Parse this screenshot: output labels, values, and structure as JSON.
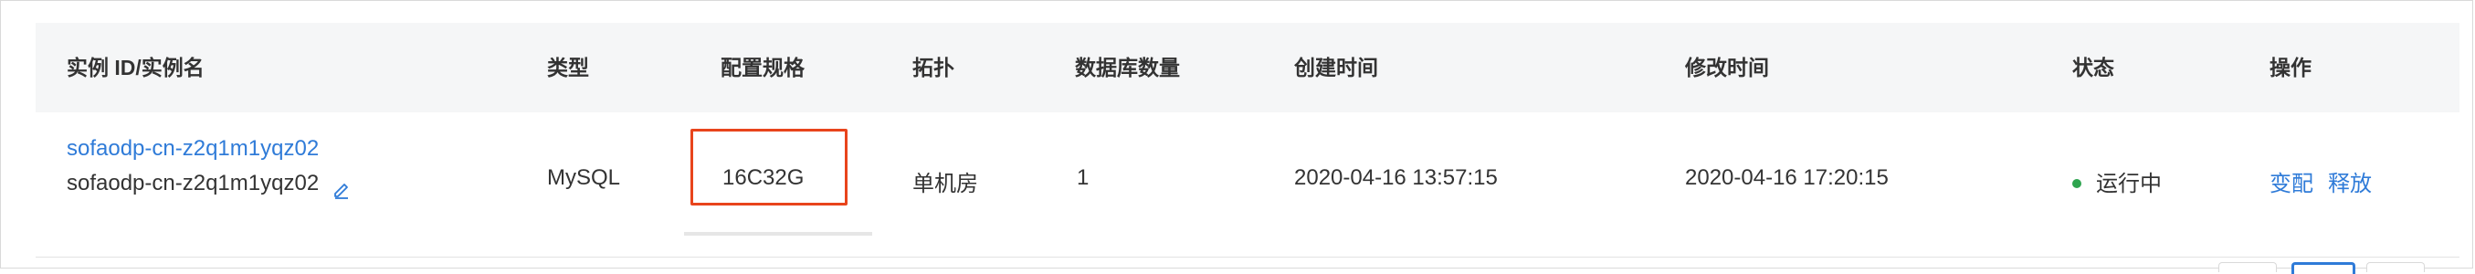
{
  "columns": {
    "instance": "实例 ID/实例名",
    "type": "类型",
    "spec": "配置规格",
    "topology": "拓扑",
    "db_count": "数据库数量",
    "created": "创建时间",
    "modified": "修改时间",
    "status": "状态",
    "actions": "操作"
  },
  "row": {
    "instance_id": "sofaodp-cn-z2q1m1yqz02",
    "instance_name": "sofaodp-cn-z2q1m1yqz02",
    "type": "MySQL",
    "spec": "16C32G",
    "topology": "单机房",
    "db_count": "1",
    "created": "2020-04-16 13:57:15",
    "modified": "2020-04-16 17:20:15",
    "status": "运行中",
    "action_change": "变配",
    "action_release": "释放"
  },
  "colors": {
    "link": "#2f7bd8",
    "highlight": "#e8441c",
    "status_running": "#2ea44f",
    "header_bg": "#f5f6f7"
  },
  "icons": {
    "edit": "pencil-edit-icon",
    "status": "status-dot"
  }
}
